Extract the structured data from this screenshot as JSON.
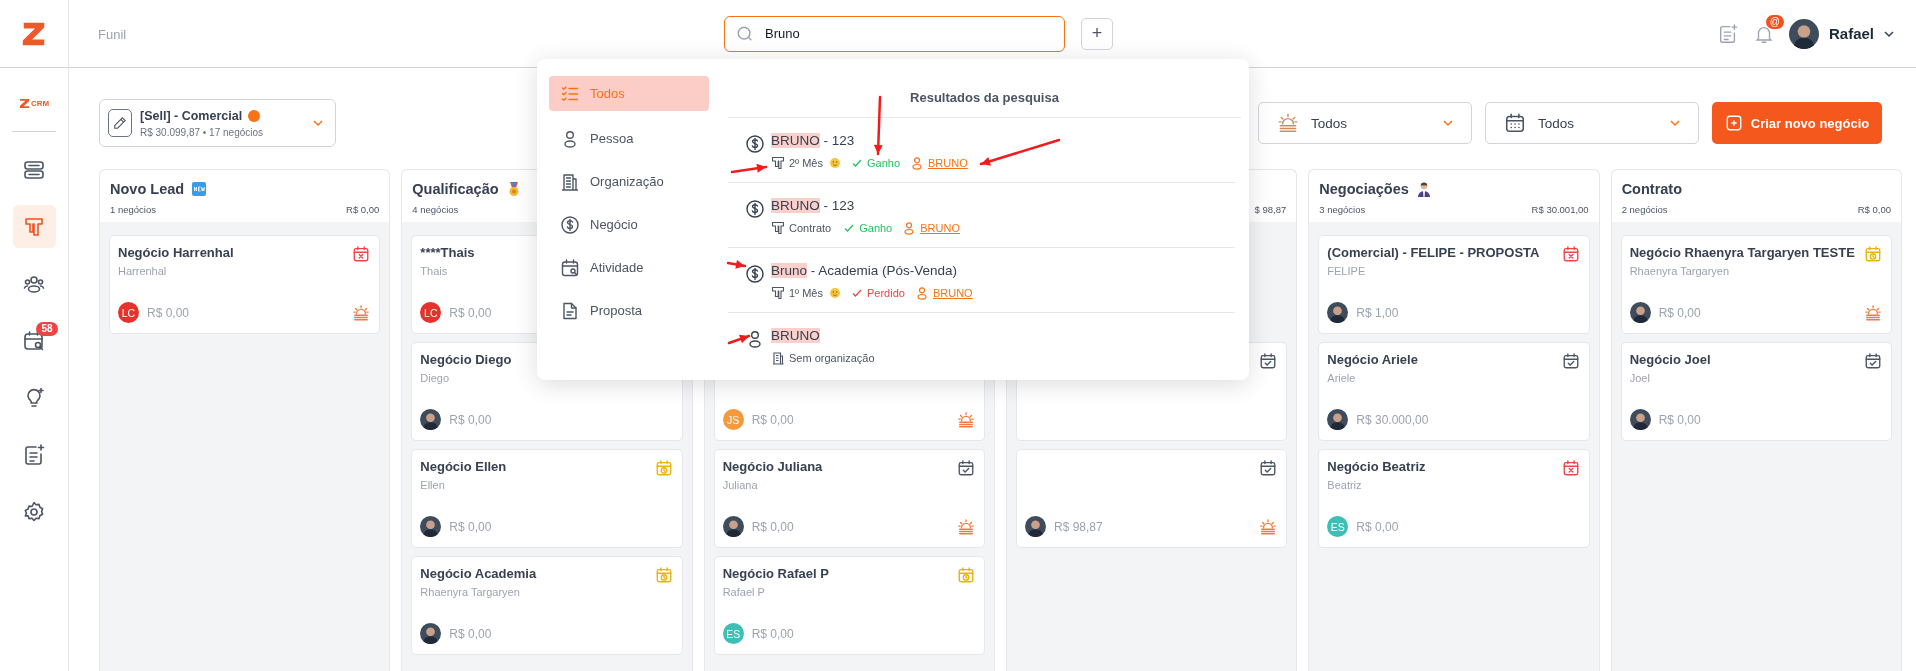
{
  "header": {
    "breadcrumb": "Funil",
    "search": {
      "value": "Bruno"
    },
    "add_button": "+",
    "notification_badge": "@",
    "user": {
      "name": "Rafael"
    }
  },
  "sidebar": {
    "brand_text": "CRM",
    "items": [
      {
        "kind": "servers",
        "selected": false
      },
      {
        "kind": "funnel",
        "selected": true
      },
      {
        "kind": "people",
        "selected": false
      },
      {
        "kind": "activities",
        "selected": false,
        "badge": "58"
      },
      {
        "kind": "ideas",
        "selected": false
      },
      {
        "kind": "notes",
        "selected": false
      },
      {
        "kind": "settings",
        "selected": false
      }
    ]
  },
  "pipeline": {
    "name": "[Sell] - Comercial",
    "color": "#f97316",
    "summary": "R$ 30.099,87 • 17 negócios"
  },
  "filters": [
    {
      "kind": "temperature",
      "value": "Todos"
    },
    {
      "kind": "date",
      "value": "Todos"
    }
  ],
  "create_button": "Criar novo negócio",
  "columns": [
    {
      "title": "Novo Lead",
      "count": "1 negócios",
      "total": "R$ 0,00",
      "cards": [
        {
          "kind": "overdue",
          "title": "Negócio Harrenhal",
          "subtitle": "Harrenhal",
          "avatar": {
            "kind": "initials",
            "initials": "LC",
            "color": "#e5322d"
          },
          "value": "R$ 0,00",
          "hot": true
        }
      ]
    },
    {
      "title": "Qualificação",
      "count": "4 negócios",
      "cards": [
        {
          "title": "****Thais",
          "subtitle": "Thais",
          "avatar": {
            "kind": "initials",
            "initials": "LC",
            "color": "#e5322d"
          },
          "value": "R$ 0,00"
        },
        {
          "title": "Negócio Diego",
          "subtitle": "Diego",
          "avatar": {
            "kind": "photo"
          },
          "value": "R$ 0,00",
          "hot": false
        },
        {
          "kind": "scheduled",
          "title": "Negócio Ellen",
          "subtitle": "Ellen",
          "avatar": {
            "kind": "photo"
          },
          "value": "R$ 0,00",
          "hot": false
        },
        {
          "kind": "scheduled",
          "title": "Negócio Academia",
          "subtitle": "Rhaenyra Targaryen",
          "avatar": {
            "kind": "photo"
          },
          "value": "R$ 0,00",
          "hot": false
        }
      ]
    },
    {
      "cards": [
        {
          "avatar": {
            "kind": "initials",
            "initials": "JS",
            "color": "#f5993d"
          },
          "value": "R$ 0,00",
          "hot": true
        },
        {
          "kind": "done",
          "title": "Negócio Juliana",
          "subtitle": "Juliana",
          "avatar": {
            "kind": "photo"
          },
          "value": "R$ 0,00",
          "hot": true
        },
        {
          "kind": "scheduled",
          "title": "Negócio Rafael P",
          "subtitle": "Rafael P",
          "avatar": {
            "kind": "initials",
            "initials": "ES",
            "color": "#3dbfb5"
          },
          "value": "R$ 0,00",
          "hot": false
        }
      ]
    },
    {
      "total": "$ 98,87",
      "cards": [
        {
          "kind": "done"
        },
        {
          "kind": "done",
          "avatar": {
            "kind": "photo"
          },
          "value": "R$ 98,87",
          "hot": true
        }
      ]
    },
    {
      "title": "Negociações",
      "count": "3 negócios",
      "total": "R$ 30.001,00",
      "cards": [
        {
          "kind": "overdue",
          "title": "(Comercial) - FELIPE - PROPOSTA",
          "subtitle": "FELIPE",
          "avatar": {
            "kind": "photo"
          },
          "value": "R$ 1,00",
          "hot": false
        },
        {
          "kind": "done",
          "title": "Negócio Ariele",
          "subtitle": "Ariele",
          "avatar": {
            "kind": "photo"
          },
          "value": "R$ 30.000,00",
          "hot": false
        },
        {
          "kind": "overdue",
          "title": "Negócio Beatriz",
          "subtitle": "Beatriz",
          "avatar": {
            "kind": "initials",
            "initials": "ES",
            "color": "#3dbfb5"
          },
          "value": "R$ 0,00",
          "hot": false
        }
      ]
    },
    {
      "title": "Contrato",
      "count": "2 negócios",
      "total": "R$ 0,00",
      "cards": [
        {
          "kind": "scheduled",
          "title": "Negócio Rhaenyra Targaryen TESTE",
          "subtitle": "Rhaenyra Targaryen",
          "avatar": {
            "kind": "photo"
          },
          "value": "R$ 0,00",
          "hot": true
        },
        {
          "kind": "done",
          "title": "Negócio Joel",
          "subtitle": "Joel",
          "avatar": {
            "kind": "photo"
          },
          "value": "R$ 0,00",
          "hot": false
        }
      ]
    }
  ],
  "search_dropdown": {
    "title": "Resultados da pesquisa",
    "categories": [
      {
        "kind": "all",
        "label": "Todos",
        "selected": true
      },
      {
        "kind": "person",
        "label": "Pessoa",
        "selected": false
      },
      {
        "kind": "organization",
        "label": "Organização",
        "selected": false
      },
      {
        "kind": "deal",
        "label": "Negócio",
        "selected": false
      },
      {
        "kind": "activity",
        "label": "Atividade",
        "selected": false
      },
      {
        "kind": "proposal",
        "label": "Proposta",
        "selected": false
      }
    ],
    "results": [
      {
        "kind": "deal",
        "match": "BRUNO",
        "rest": " - 123",
        "stage": "2º Mês",
        "stage_emoji": true,
        "status": {
          "kind": "won",
          "label": "Ganho"
        },
        "person": "BRUNO"
      },
      {
        "kind": "deal",
        "match": "BRUNO",
        "rest": " - 123",
        "stage": "Contrato",
        "stage_emoji": false,
        "status": {
          "kind": "won",
          "label": "Ganho"
        },
        "person": "BRUNO"
      },
      {
        "kind": "deal",
        "match": "Bruno",
        "rest": " - Academia (Pós-Venda)",
        "stage": "1º Mês",
        "stage_emoji": true,
        "status": {
          "kind": "lost",
          "label": "Perdido"
        },
        "person": "BRUNO"
      },
      {
        "kind": "person",
        "match": "BRUNO",
        "organization": "Sem organização"
      }
    ]
  }
}
